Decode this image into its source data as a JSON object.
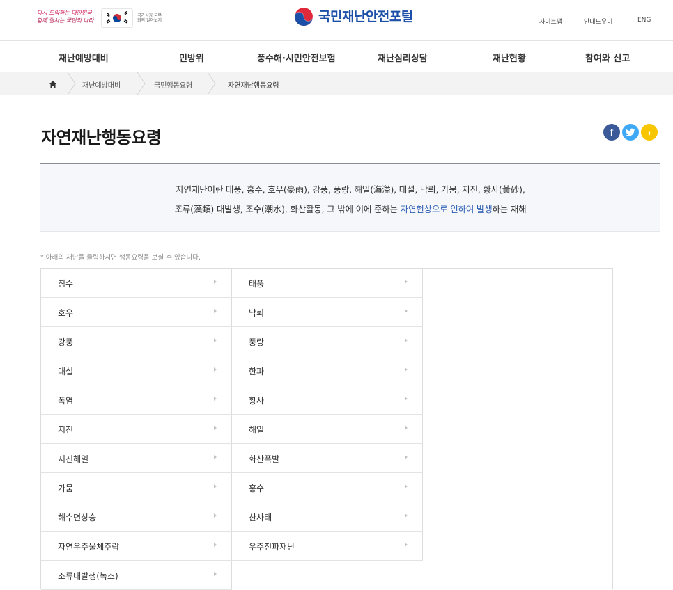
{
  "promo": {
    "slogan_line1": "다시 도약하는 대한민국",
    "slogan_line2": "함께 잘사는 국민의 나라",
    "caption": "국가상징 국무회의 알아보기"
  },
  "brand": {
    "title": "국민재난안전포털"
  },
  "utility": {
    "sitemap": "사이트맵",
    "guide": "안내도우미",
    "lang": "ENG"
  },
  "gnb": {
    "items": [
      "재난예방대비",
      "민방위",
      "풍수해·시민안전보험",
      "재난심리상담",
      "재난현황",
      "참여와 신고"
    ]
  },
  "breadcrumb": {
    "level1": "재난예방대비",
    "level2": "국민행동요령",
    "level3": "자연재난행동요령"
  },
  "page": {
    "title": "자연재난행동요령"
  },
  "share": {
    "facebook_glyph": "f",
    "twitter_glyph": "t",
    "kakao_glyph": ","
  },
  "definition": {
    "line1": "자연재난이란 태풍, 홍수, 호우(豪雨), 강풍, 풍랑, 해일(海溢), 대설, 낙뢰, 가뭄, 지진, 황사(黃砂),",
    "line2_before": "조류(藻類) 대발생, 조수(潮水), 화산활동, 그 밖에 이에 준하는 ",
    "line2_highlight": "자연현상으로 인하여 발생",
    "line2_after": "하는 재해"
  },
  "note": "* 아래의 재난을 클릭하시면 행동요령을 보실 수 있습니다.",
  "disasters": {
    "col1": [
      "침수",
      "호우",
      "강풍",
      "대설",
      "폭염",
      "지진",
      "지진해일",
      "가뭄",
      "해수면상승",
      "자연우주물체추락",
      "조류대발생(녹조)"
    ],
    "col2": [
      "태풍",
      "낙뢰",
      "풍랑",
      "한파",
      "황사",
      "해일",
      "화산폭발",
      "홍수",
      "산사태",
      "우주전파재난"
    ]
  },
  "colors": {
    "brand_blue": "#1b4fa8",
    "highlight_blue": "#2f5fb3",
    "facebook": "#3b5998",
    "twitter": "#3fa9f5",
    "kakao": "#f7c600"
  },
  "icons": [
    "taegeuk-flag-icon",
    "brand-logo-icon",
    "home-icon",
    "chevron-right-icon",
    "facebook-icon",
    "twitter-icon",
    "kakao-story-icon",
    "arrow-right-icon"
  ]
}
